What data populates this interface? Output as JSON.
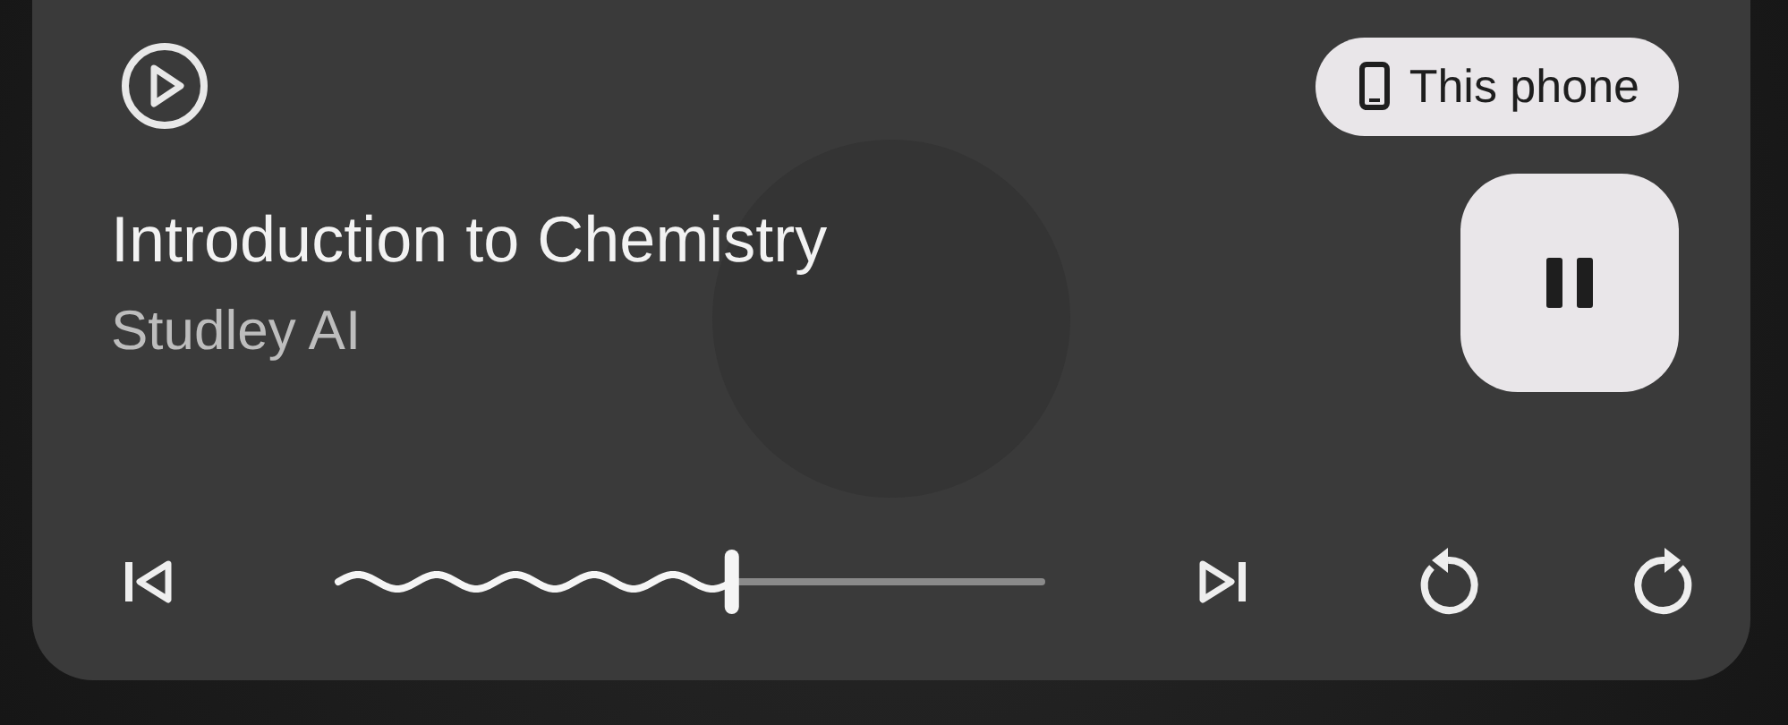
{
  "output_chip": {
    "label": "This phone"
  },
  "title": "Introduction to Chemistry",
  "artist": "Studley AI",
  "playback": {
    "playing": true
  },
  "seek": {
    "level": 0.56
  }
}
